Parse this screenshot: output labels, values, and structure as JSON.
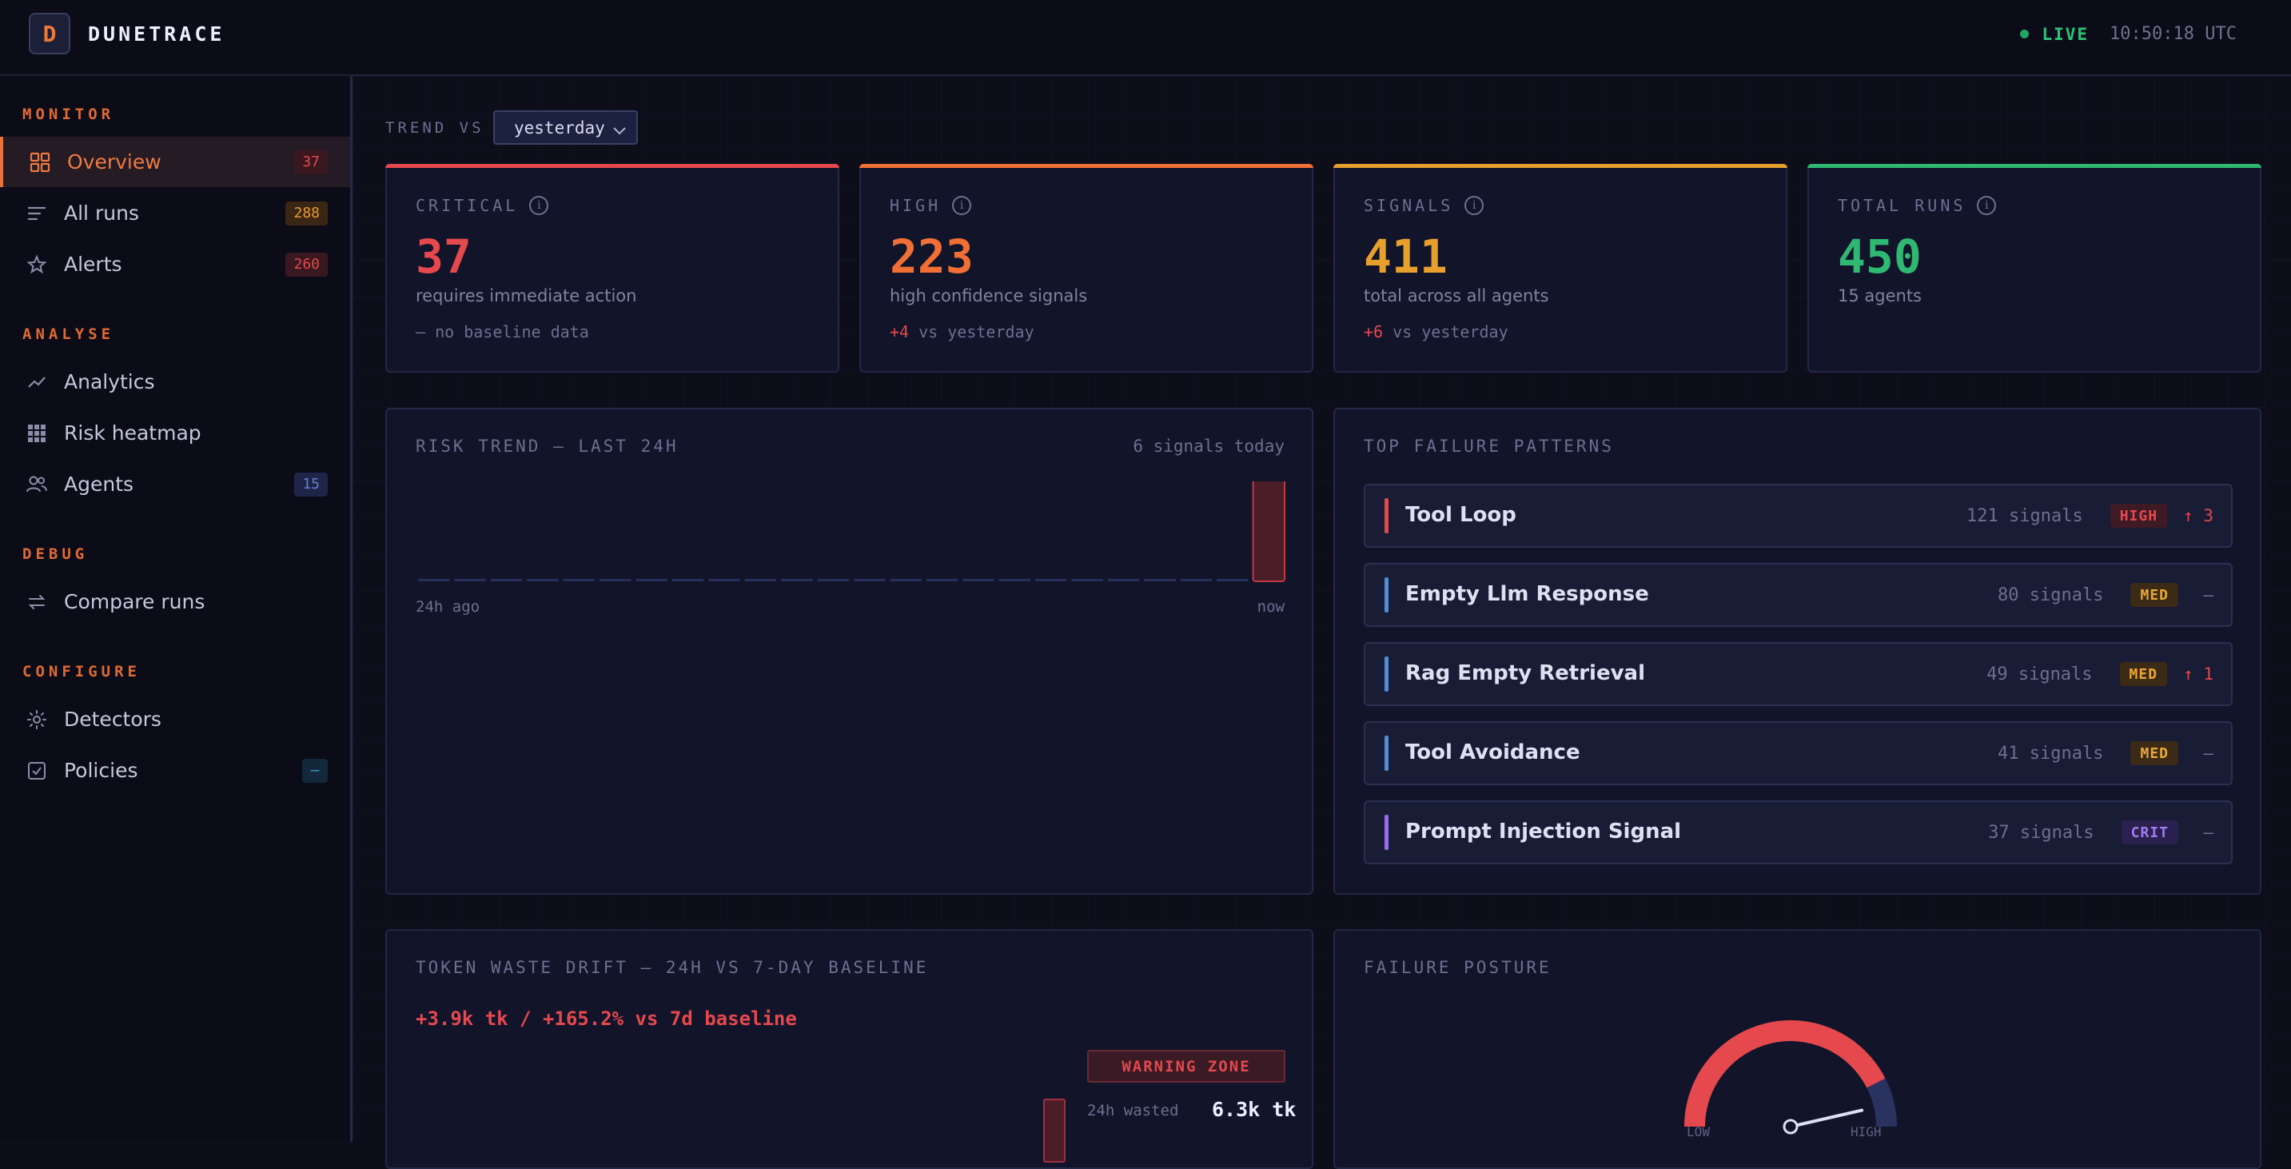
{
  "app": {
    "logo_letter": "D",
    "name": "DUNETRACE",
    "live_label": "LIVE",
    "clock": "10:50:18 UTC"
  },
  "sidebar": {
    "sections": [
      {
        "title": "MONITOR"
      },
      {
        "title": "ANALYSE"
      },
      {
        "title": "DEBUG"
      },
      {
        "title": "CONFIGURE"
      }
    ],
    "items": [
      {
        "label": "Overview",
        "badge": "37",
        "icon": "grid-icon",
        "active": true
      },
      {
        "label": "All runs",
        "badge": "288",
        "icon": "list-icon"
      },
      {
        "label": "Alerts",
        "badge": "260",
        "icon": "star-icon"
      },
      {
        "label": "Analytics",
        "icon": "trend-icon"
      },
      {
        "label": "Risk heatmap",
        "icon": "heatmap-icon"
      },
      {
        "label": "Agents",
        "badge": "15",
        "icon": "users-icon"
      },
      {
        "label": "Compare runs",
        "icon": "compare-icon"
      },
      {
        "label": "Detectors",
        "icon": "sun-icon"
      },
      {
        "label": "Policies",
        "badge": "—",
        "icon": "checkbox-icon"
      }
    ]
  },
  "trend": {
    "label": "TREND VS",
    "selected": "yesterday"
  },
  "stats": [
    {
      "label": "CRITICAL",
      "value": "37",
      "sub": "requires immediate action",
      "delta_prefix": "",
      "delta_text": "— no baseline data",
      "color": "#e5484d"
    },
    {
      "label": "HIGH",
      "value": "223",
      "sub": "high confidence signals",
      "delta_prefix": "+4",
      "delta_text": " vs yesterday",
      "color": "#ef6f35"
    },
    {
      "label": "SIGNALS",
      "value": "411",
      "sub": "total across all agents",
      "delta_prefix": "+6",
      "delta_text": " vs yesterday",
      "color": "#e8a02c"
    },
    {
      "label": "TOTAL RUNS",
      "value": "450",
      "sub": "15 agents",
      "delta_prefix": "",
      "delta_text": "",
      "color": "#2fb872"
    }
  ],
  "risk_trend": {
    "title": "RISK TREND — LAST 24H",
    "summary": "6 signals today",
    "x_start": "24h ago",
    "x_end": "now"
  },
  "chart_data": {
    "type": "bar",
    "categories": [
      "24h ago",
      "",
      "",
      "",
      "",
      "",
      "",
      "",
      "",
      "",
      "",
      "",
      "",
      "",
      "",
      "",
      "",
      "",
      "",
      "",
      "",
      "",
      "",
      "now"
    ],
    "values": [
      0,
      0,
      0,
      0,
      0,
      0,
      0,
      0,
      0,
      0,
      0,
      0,
      0,
      0,
      0,
      0,
      0,
      0,
      0,
      0,
      0,
      0,
      0,
      6
    ]
  },
  "failure_patterns": {
    "title": "TOP FAILURE PATTERNS",
    "rows": [
      {
        "name": "Tool Loop",
        "count": "121 signals",
        "severity": "HIGH",
        "trend": "↑ 3",
        "bar_color": "#e5484d"
      },
      {
        "name": "Empty Llm Response",
        "count": "80 signals",
        "severity": "MED",
        "trend": "—",
        "bar_color": "#4f8fd8"
      },
      {
        "name": "Rag Empty Retrieval",
        "count": "49 signals",
        "severity": "MED",
        "trend": "↑ 1",
        "bar_color": "#4f8fd8"
      },
      {
        "name": "Tool Avoidance",
        "count": "41 signals",
        "severity": "MED",
        "trend": "—",
        "bar_color": "#4f8fd8"
      },
      {
        "name": "Prompt Injection Signal",
        "count": "37 signals",
        "severity": "CRIT",
        "trend": "—",
        "bar_color": "#9a6cf0"
      }
    ]
  },
  "token_waste": {
    "title": "TOKEN WASTE DRIFT — 24H VS 7-DAY BASELINE",
    "headline": "+3.9k tk / +165.2% vs 7d baseline",
    "zone": "WARNING ZONE",
    "wasted_label": "24h wasted",
    "wasted_value": "6.3k tk"
  },
  "failure_posture": {
    "title": "FAILURE POSTURE",
    "low_label": "LOW",
    "high_label": "HIGH",
    "level": 0.85
  }
}
